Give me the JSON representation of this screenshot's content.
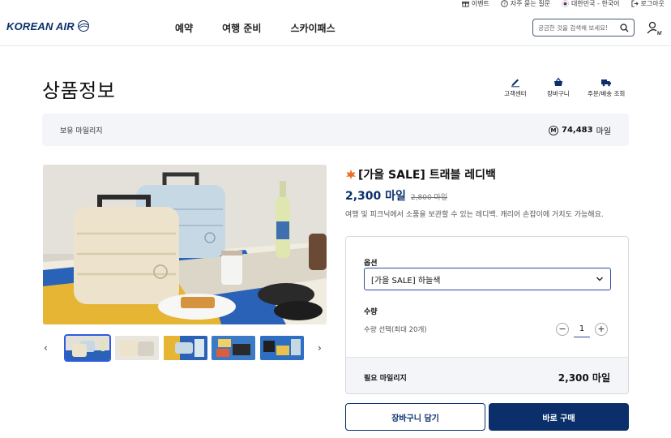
{
  "util_bar": {
    "items": [
      {
        "icon": "gift-icon",
        "label": "이벤트"
      },
      {
        "icon": "question-icon",
        "label": "자주 묻는 질문"
      },
      {
        "icon": "flag-kr-icon",
        "label": "대한민국 - 한국어"
      },
      {
        "icon": "logout-icon",
        "label": "로그아웃"
      }
    ]
  },
  "header": {
    "logo_text": "KOREAN AIR",
    "nav": [
      "예약",
      "여행 준비",
      "스카이패스"
    ],
    "search_placeholder": "궁금한 것을 검색해 보세요!",
    "my_label": "MY"
  },
  "page": {
    "title": "상품정보",
    "quick_links": [
      {
        "icon": "pencil-icon",
        "label": "고객센터"
      },
      {
        "icon": "basket-icon",
        "label": "장바구니"
      },
      {
        "icon": "truck-icon",
        "label": "주문/배송 조회"
      }
    ]
  },
  "mileage": {
    "label": "보유 마일리지",
    "icon_letter": "M",
    "value": "74,483",
    "unit": "마일"
  },
  "product": {
    "title": "[가을 SALE] 트래블 레디백",
    "price": "2,300 마일",
    "original_price": "2,800 마일",
    "description": "여행 및 피크닉에서 소품을 보관할 수 있는 레디백. 캐리어 손잡이에 거치도 가능해요.",
    "option_label": "옵션",
    "selected_option": "[가을 SALE] 하늘색",
    "quantity_label": "수량",
    "quantity_hint": "수량 선택(최대 20개)",
    "quantity": "1",
    "required_label": "필요 마일리지",
    "required_value": "2,300 마일",
    "thumbnail_count": 5,
    "active_thumbnail": 1
  },
  "buttons": {
    "cart": "장바구니 담기",
    "buy": "바로 구매"
  },
  "colors": {
    "brand_navy": "#0a2f6b",
    "select_border": "#2a4e9a",
    "panel_bg": "#f3f5f8"
  }
}
